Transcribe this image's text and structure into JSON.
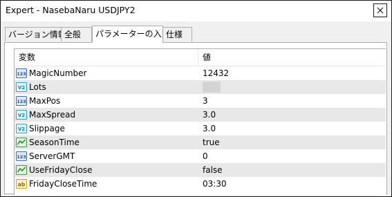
{
  "window": {
    "title": "Expert - NasebaNaru USDJPY2"
  },
  "tabs": [
    {
      "label": "バージョン情報",
      "active": false
    },
    {
      "label": "全般",
      "active": false
    },
    {
      "label": "パラメーターの入力",
      "active": true
    },
    {
      "label": "仕様",
      "active": false
    }
  ],
  "grid": {
    "headers": {
      "variable": "変数",
      "value": "値"
    },
    "rows": [
      {
        "name": "MagicNumber",
        "value": "12432",
        "icon": "int-icon"
      },
      {
        "name": "Lots",
        "value": "",
        "icon": "double-icon"
      },
      {
        "name": "MaxPos",
        "value": "3",
        "icon": "int-icon"
      },
      {
        "name": "MaxSpread",
        "value": "3.0",
        "icon": "double-icon"
      },
      {
        "name": "Slippage",
        "value": "3.0",
        "icon": "double-icon"
      },
      {
        "name": "SeasonTime",
        "value": "true",
        "icon": "bool-icon"
      },
      {
        "name": "ServerGMT",
        "value": "0",
        "icon": "int-icon"
      },
      {
        "name": "UseFridayClose",
        "value": "false",
        "icon": "bool-icon"
      },
      {
        "name": "FridayCloseTime",
        "value": "03:30",
        "icon": "string-icon"
      }
    ]
  },
  "colors": {
    "row_alt": "#e8e8e8",
    "int_icon": "#3a6fb5",
    "double_icon": "#2ea5c7",
    "bool_icon": "#3d9b3d",
    "string_icon": "#d4a017"
  }
}
